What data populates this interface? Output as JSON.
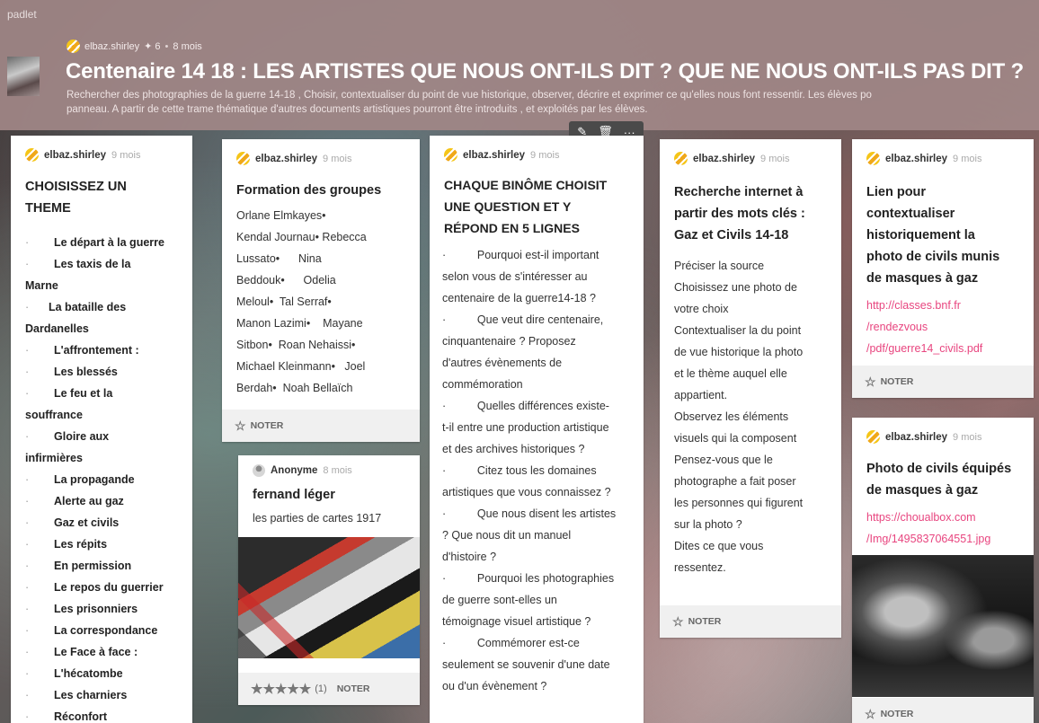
{
  "header": {
    "brand": "padlet",
    "author": "elbaz.shirley",
    "contributors": "✦ 6",
    "age": "8 mois",
    "title": "Centenaire 14 18 : LES ARTISTES QUE NOUS ONT-ILS DIT ? QUE NE NOUS ONT-ILS PAS DIT ?",
    "description_line1": "Rechercher des photographies de la guerre 14-18 , Choisir, contextualiser du point de vue historique, observer, décrire et exprimer ce qu'elles nous font ressentir. Les élèves po",
    "description_line2": "panneau. A partir de cette trame thématique d'autres documents artistiques pourront être introduits , et exploités par les élèves."
  },
  "toolbar": {
    "edit_icon": "✎",
    "delete_icon": "🗑",
    "more_icon": "···"
  },
  "common": {
    "note_label": "NOTER",
    "time": "9 mois",
    "author": "elbaz.shirley"
  },
  "card1": {
    "title_line1": "CHOISISSEZ UN",
    "title_line2": "THEME",
    "items": [
      {
        "label": "Le départ à la guerre"
      },
      {
        "label": "Les taxis de la",
        "cont": "Marne"
      },
      {
        "label": "La  bataille des",
        "cont": "Dardanelles"
      },
      {
        "label": "L'affrontement :"
      },
      {
        "label": "Les blessés"
      },
      {
        "label": "Le feu et la",
        "cont": "souffrance"
      },
      {
        "label": "Gloire aux",
        "cont": "infirmières"
      },
      {
        "label": "La propagande"
      },
      {
        "label": "Alerte au gaz"
      },
      {
        "label": "Gaz et civils"
      },
      {
        "label": "Les répits"
      },
      {
        "label": "En permission"
      },
      {
        "label": "Le repos du guerrier"
      },
      {
        "label": "Les prisonniers"
      },
      {
        "label": "La correspondance"
      },
      {
        "label": "Le Face à face :"
      },
      {
        "label": "L'hécatombe"
      },
      {
        "label": "Les charniers"
      },
      {
        "label": "Réconfort"
      }
    ]
  },
  "card2": {
    "title": "Formation des groupes",
    "lines": [
      "Orlane Elmkayes•",
      "Kendal Journau•  Rebecca",
      "Lussato•      Nina",
      "Beddouk•      Odelia",
      "Meloul•  Tal Serraf•",
      "Manon Lazimi•    Mayane",
      "Sitbon•  Roan Nehaissi•",
      "Michael Kleinmann•   Joel",
      "Berdah•  Noah Bellaïch"
    ]
  },
  "card3": {
    "author": "Anonyme",
    "time": "8 mois",
    "title": "fernand léger",
    "body": "les parties de cartes 1917",
    "rating_stars": "★★★★★",
    "rating_count": "(1)"
  },
  "card4": {
    "title_lines": [
      "CHAQUE BINÔME CHOISIT",
      "UNE QUESTION ET Y",
      "RÉPOND EN  5 LIGNES"
    ],
    "lines": [
      "·          Pourquoi est-il important",
      "selon vous de s'intéresser au",
      "centenaire de la guerre14-18 ?",
      "·          Que veut dire centenaire,",
      "cinquantenaire ? Proposez",
      "d'autres évènements de",
      "commémoration",
      "·          Quelles différences existe-",
      "t-il entre une production artistique",
      "et des archives historiques ?",
      "·          Citez tous les domaines",
      "artistiques que vous connaissez ?",
      "·          Que nous disent les artistes",
      "? Que nous dit un manuel",
      "d'histoire ?",
      "·          Pourquoi les photographies",
      "de guerre sont-elles un",
      "témoignage visuel artistique ?",
      "·          Commémorer est-ce",
      "seulement se souvenir d'une date",
      "ou d'un évènement ?"
    ]
  },
  "card5": {
    "title_lines": [
      "Recherche internet à",
      "partir des mots clés :",
      "Gaz et Civils 14-18"
    ],
    "lines": [
      "Préciser la source",
      "Choisissez une photo de",
      "votre choix",
      "Contextualiser la du point",
      "de vue historique la photo",
      "et le thème auquel elle",
      "appartient.",
      "Observez les éléments",
      "visuels qui la composent",
      "Pensez-vous que le",
      "photographe a fait poser",
      "les personnes qui figurent",
      "sur la photo ?",
      "Dites ce que vous",
      "ressentez."
    ]
  },
  "card6": {
    "title_lines": [
      "Lien pour",
      "contextualiser",
      "historiquement la",
      "photo de civils munis",
      "de masques à gaz"
    ],
    "link_lines": [
      "http://classes.bnf.fr",
      "/rendezvous",
      "/pdf/guerre14_civils.pdf"
    ]
  },
  "card7": {
    "title_lines": [
      "Photo de civils équipés",
      "de masques à gaz"
    ],
    "link_lines": [
      "https://choualbox.com",
      "/Img/1495837064551.jpg"
    ]
  }
}
